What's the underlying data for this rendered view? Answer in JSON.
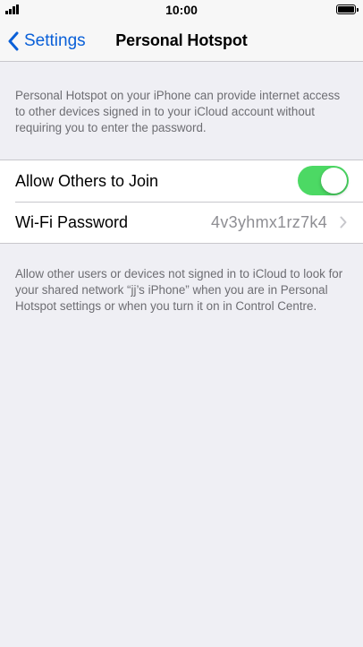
{
  "status_bar": {
    "time": "10:00",
    "signal_icon": "signal-bars-icon",
    "battery_icon": "battery-full-icon"
  },
  "nav": {
    "back_label": "Settings",
    "back_icon": "chevron-left-icon",
    "title": "Personal Hotspot"
  },
  "intro_text": "Personal Hotspot on your iPhone can provide internet access to other devices signed in to your iCloud account without requiring you to enter the password.",
  "settings": {
    "allow_others": {
      "label": "Allow Others to Join",
      "enabled": true
    },
    "wifi_password": {
      "label": "Wi-Fi Password",
      "value": "4v3yhmx1rz7k4",
      "icon": "chevron-right-icon"
    }
  },
  "footer_text": "Allow other users or devices not signed in to iCloud to look for your shared network “jj’s iPhone” when you are in Personal Hotspot settings or when you turn it on in Control Centre.",
  "colors": {
    "accent": "#0a60d8",
    "toggle_on": "#4cd964",
    "background": "#efeff4",
    "secondary_text": "#6d6d72"
  }
}
